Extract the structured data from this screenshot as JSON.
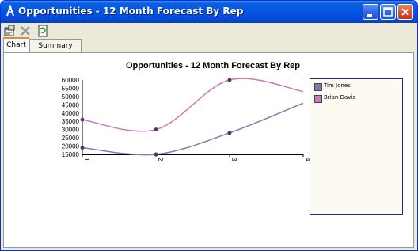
{
  "window": {
    "title": "Opportunities - 12 Month Forecast By Rep",
    "accent_color": "#0554e4",
    "close_color": "#d4502a"
  },
  "toolbar": {
    "icons": [
      "properties-icon",
      "delete-icon",
      "refresh-icon"
    ]
  },
  "tabs": [
    {
      "label": "Chart",
      "active": true
    },
    {
      "label": "Summary Data",
      "active": false
    }
  ],
  "chart_data": {
    "type": "line",
    "title": "Opportunities - 12 Month Forecast By Rep",
    "x": [
      1,
      2,
      3,
      4
    ],
    "x_tick_labels": [
      "1",
      "2",
      "3",
      "4"
    ],
    "y_tick_labels": [
      "60000",
      "55000",
      "50000",
      "45000",
      "40000",
      "35000",
      "30000",
      "25000",
      "20000",
      "15000"
    ],
    "ylim": [
      15000,
      60000
    ],
    "grid": false,
    "legend_position": "right",
    "series": [
      {
        "name": "Tim Jones",
        "color": "#7a7fab",
        "values": [
          19000,
          15000,
          28000,
          46000
        ]
      },
      {
        "name": "Brian Davis",
        "color": "#cc77bb",
        "values": [
          36000,
          30000,
          60000,
          53000
        ]
      }
    ],
    "marker_color": "#4b3d5f"
  }
}
